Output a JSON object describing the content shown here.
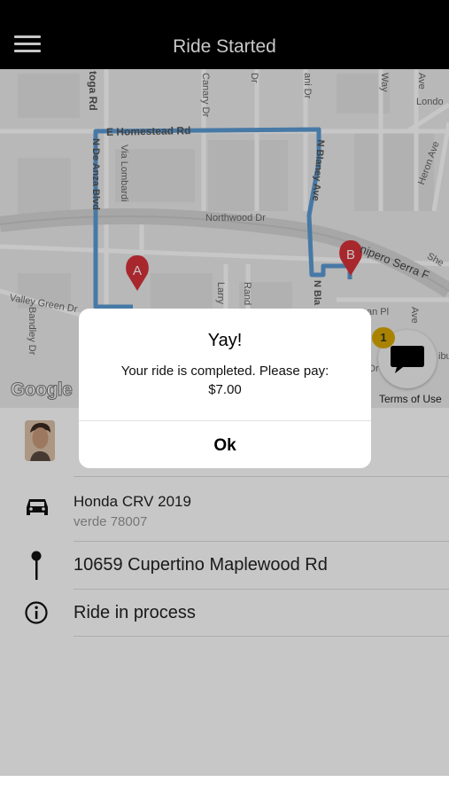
{
  "header": {
    "title": "Ride Started",
    "menu_icon": "hamburger-menu-icon"
  },
  "map": {
    "labels": {
      "saratoga": "toga Rd",
      "canary": "Canary Dr",
      "dr1": "Dr",
      "ani": "ani Dr",
      "way": "Way",
      "ave": "Ave",
      "london": "Londo",
      "homestead": "E Homestead Rd",
      "de_anza": "N De Anza Blvd",
      "lombardi": "Via Lombardi",
      "heron": "Heron Ave",
      "blaney": "N Blaney Ave",
      "northwood": "Northwood Dr",
      "junipero": "nipero Serra F",
      "she": "She",
      "valley_green": "Valley Green Dr",
      "bandley": "Bandley Dr",
      "larry": "Larry",
      "rand": "Rand",
      "bla": "N Bla",
      "an_pl": "an Pl",
      "ave2": "Ave",
      "ibu": "ibu",
      "dr2": "Dr"
    },
    "marker_a": "A",
    "marker_b": "B",
    "google_logo": "Google",
    "route_color": "#5b9bd5",
    "marker_color": "#d8323a"
  },
  "chat": {
    "badge": "1",
    "icon": "chat-bubble-icon",
    "terms": "Terms of Use"
  },
  "driver": {
    "avatar_icon": "driver-avatar"
  },
  "car": {
    "icon": "car-icon",
    "name": "Honda CRV 2019",
    "plate": "verde 78007"
  },
  "destination": {
    "icon": "pin-icon",
    "address": "10659 Cupertino Maplewood Rd"
  },
  "status": {
    "icon": "info-icon",
    "text": "Ride in process"
  },
  "dialog": {
    "title": "Yay!",
    "message_line1": "Your ride is completed. Please pay:",
    "message_line2": "$7.00",
    "ok_label": "Ok"
  }
}
